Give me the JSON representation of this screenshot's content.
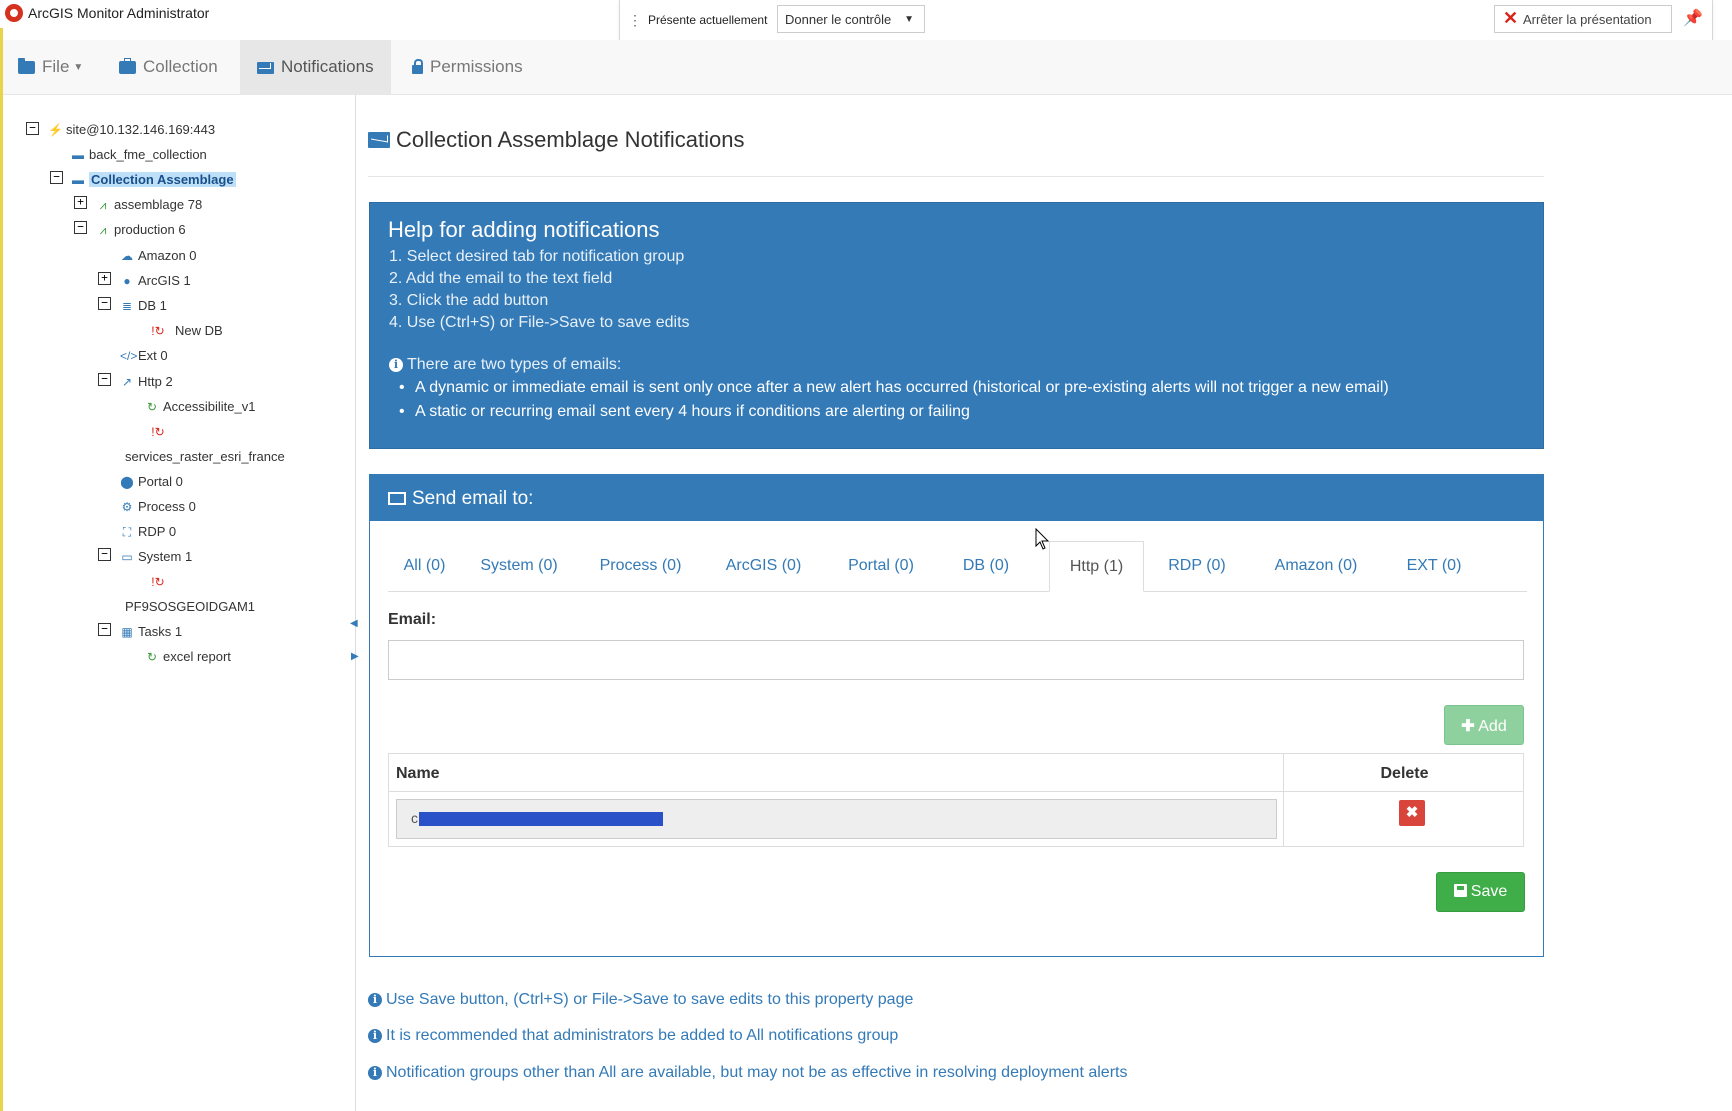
{
  "app": {
    "title": "ArcGIS Monitor Administrator"
  },
  "presentation_bar": {
    "status": "Présente actuellement",
    "control": "Donner le contrôle",
    "stop": "Arrêter la présentation"
  },
  "nav": {
    "file": "File",
    "collection": "Collection",
    "notifications": "Notifications",
    "permissions": "Permissions",
    "active": "notifications"
  },
  "tree": {
    "root": "site@10.132.146.169:443",
    "back": "back_fme_collection",
    "collection": "Collection Assemblage",
    "assemblage": "assemblage 78",
    "production": "production 6",
    "amazon": "Amazon 0",
    "arcgis": "ArcGIS 1",
    "db": "DB 1",
    "new_db": "New DB",
    "ext": "Ext 0",
    "http": "Http 2",
    "accessibilite": "Accessibilite_v1",
    "services_raster": "services_raster_esri_france",
    "portal": "Portal 0",
    "process": "Process 0",
    "rdp": "RDP 0",
    "system": "System 1",
    "pf9": "PF9SOSGEOIDGAM1",
    "tasks": "Tasks 1",
    "excel": "excel report"
  },
  "main": {
    "title": "Collection Assemblage Notifications",
    "help": {
      "title": "Help for adding notifications",
      "steps": [
        "1. Select desired tab for notification group",
        "2. Add the email to the text field",
        "3. Click the add button",
        "4. Use (Ctrl+S) or File->Save to save edits"
      ],
      "info": "There are two types of emails:",
      "bullets": [
        "A dynamic or immediate email is sent only once after a new alert has occurred (historical or pre-existing alerts will not trigger a new email)",
        "A static or recurring email sent every 4 hours if conditions are alerting or failing"
      ]
    },
    "send": {
      "title": "Send email to:",
      "tabs": [
        "All (0)",
        "System (0)",
        "Process (0)",
        "ArcGIS (0)",
        "Portal (0)",
        "DB (0)",
        "Http (1)",
        "RDP (0)",
        "Amazon (0)",
        "EXT (0)"
      ],
      "active_tab": "Http (1)",
      "email_label": "Email:",
      "email_value": "",
      "add": "Add",
      "col_name": "Name",
      "col_delete": "Delete",
      "row_value": "c",
      "save": "Save"
    },
    "notes": [
      "Use Save button, (Ctrl+S) or File->Save to save edits to this property page",
      "It is recommended that administrators be added to All notifications group",
      "Notification groups other than All are available, but may not be as effective in resolving deployment alerts"
    ]
  },
  "colors": {
    "primary": "#337ab7",
    "success": "#3fae49",
    "danger": "#d9453a",
    "selection": "#bde0f8"
  }
}
